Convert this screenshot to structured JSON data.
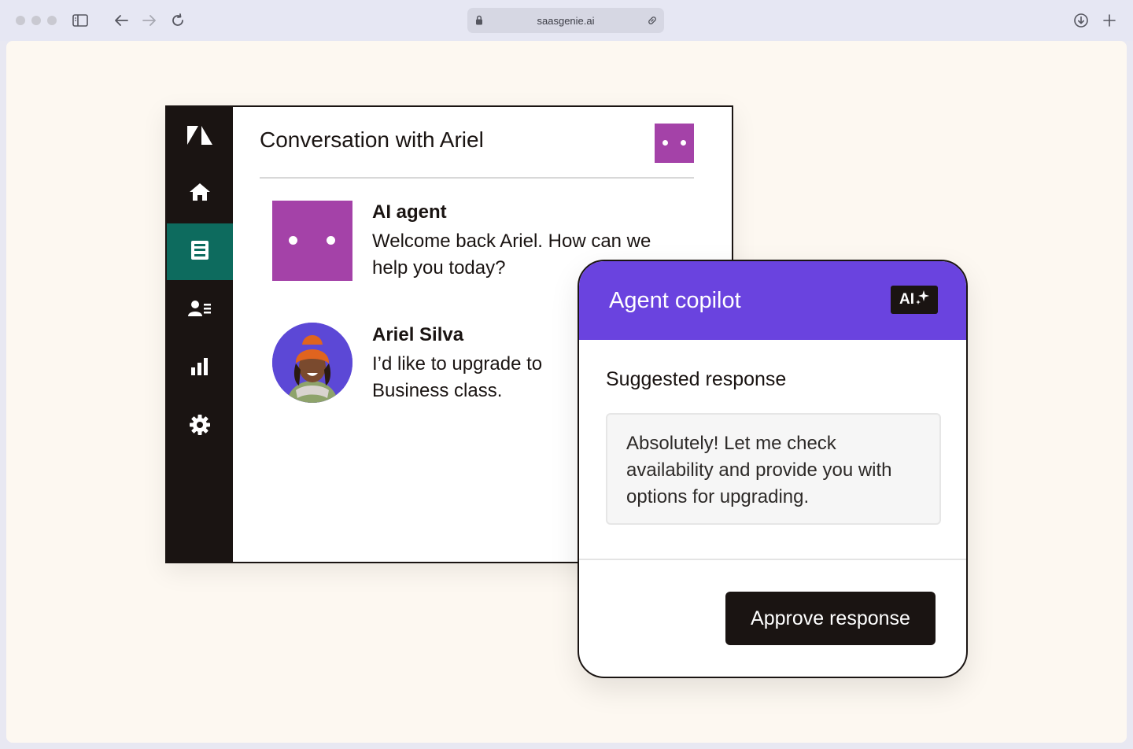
{
  "browser": {
    "url": "saasgenie.ai",
    "icons": [
      "sidebar-toggle-icon",
      "back-arrow-icon",
      "forward-arrow-icon",
      "reload-icon",
      "lock-icon",
      "link-icon",
      "download-icon",
      "new-tab-plus-icon"
    ]
  },
  "conversation": {
    "title": "Conversation with Ariel",
    "messages": [
      {
        "sender": "AI agent",
        "text": "Welcome back Ariel. How can we help you today?"
      },
      {
        "sender": "Ariel Silva",
        "text": "I’d like to upgrade to Business class."
      }
    ]
  },
  "sidebar": {
    "items": [
      "zendesk-logo",
      "home",
      "tickets",
      "contacts",
      "reporting",
      "settings"
    ],
    "active": "tickets"
  },
  "copilot": {
    "title": "Agent copilot",
    "ai_chip": "AI",
    "suggested_label": "Suggested response",
    "suggested_text": "Absolutely! Let me check availability and provide you with options for upgrading.",
    "approve_label": "Approve response"
  },
  "colors": {
    "accent_purple": "#6a43df",
    "avatar_purple": "#a442a8",
    "active_green": "#0d6b5e",
    "dark": "#1a1412",
    "background": "#fdf8f1"
  }
}
